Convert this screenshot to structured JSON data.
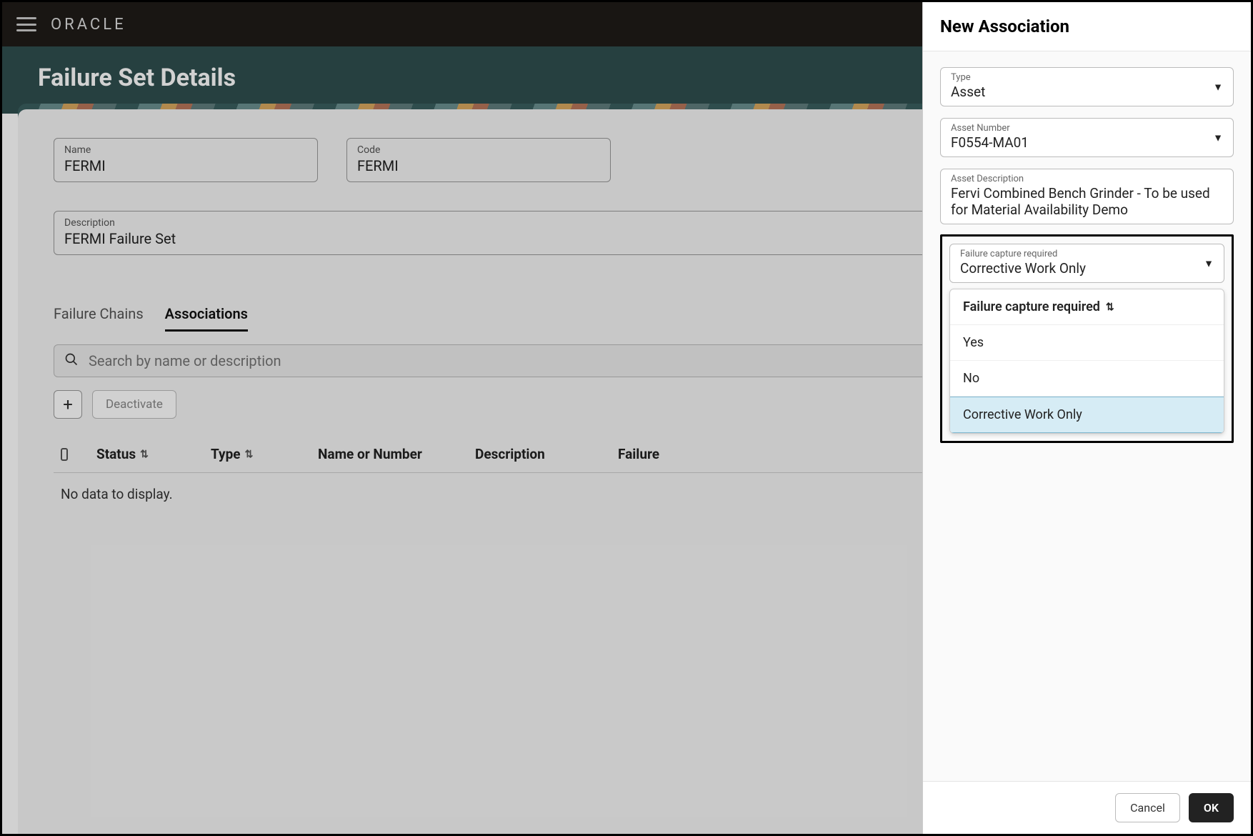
{
  "brand": "ORACLE",
  "page_title": "Failure Set Details",
  "fields": {
    "name_label": "Name",
    "name_value": "FERMI",
    "code_label": "Code",
    "code_value": "FERMI",
    "description_label": "Description",
    "description_value": "FERMI Failure Set"
  },
  "tabs": {
    "failure_chains": "Failure Chains",
    "associations": "Associations"
  },
  "search": {
    "placeholder": "Search by name or description"
  },
  "toolbar": {
    "deactivate": "Deactivate"
  },
  "table": {
    "columns": {
      "status": "Status",
      "type": "Type",
      "name": "Name or Number",
      "description": "Description",
      "failure": "Failure"
    },
    "no_data": "No data to display."
  },
  "drawer": {
    "title": "New Association",
    "type_label": "Type",
    "type_value": "Asset",
    "asset_number_label": "Asset Number",
    "asset_number_value": "F0554-MA01",
    "asset_description_label": "Asset Description",
    "asset_description_value": "Fervi Combined Bench Grinder - To be used for Material Availability Demo",
    "failure_capture_label": "Failure capture required",
    "failure_capture_value": "Corrective Work Only",
    "dropdown": {
      "header": "Failure capture required",
      "options": [
        "Yes",
        "No",
        "Corrective Work Only"
      ],
      "selected_index": 2
    },
    "cancel": "Cancel",
    "ok": "OK"
  }
}
